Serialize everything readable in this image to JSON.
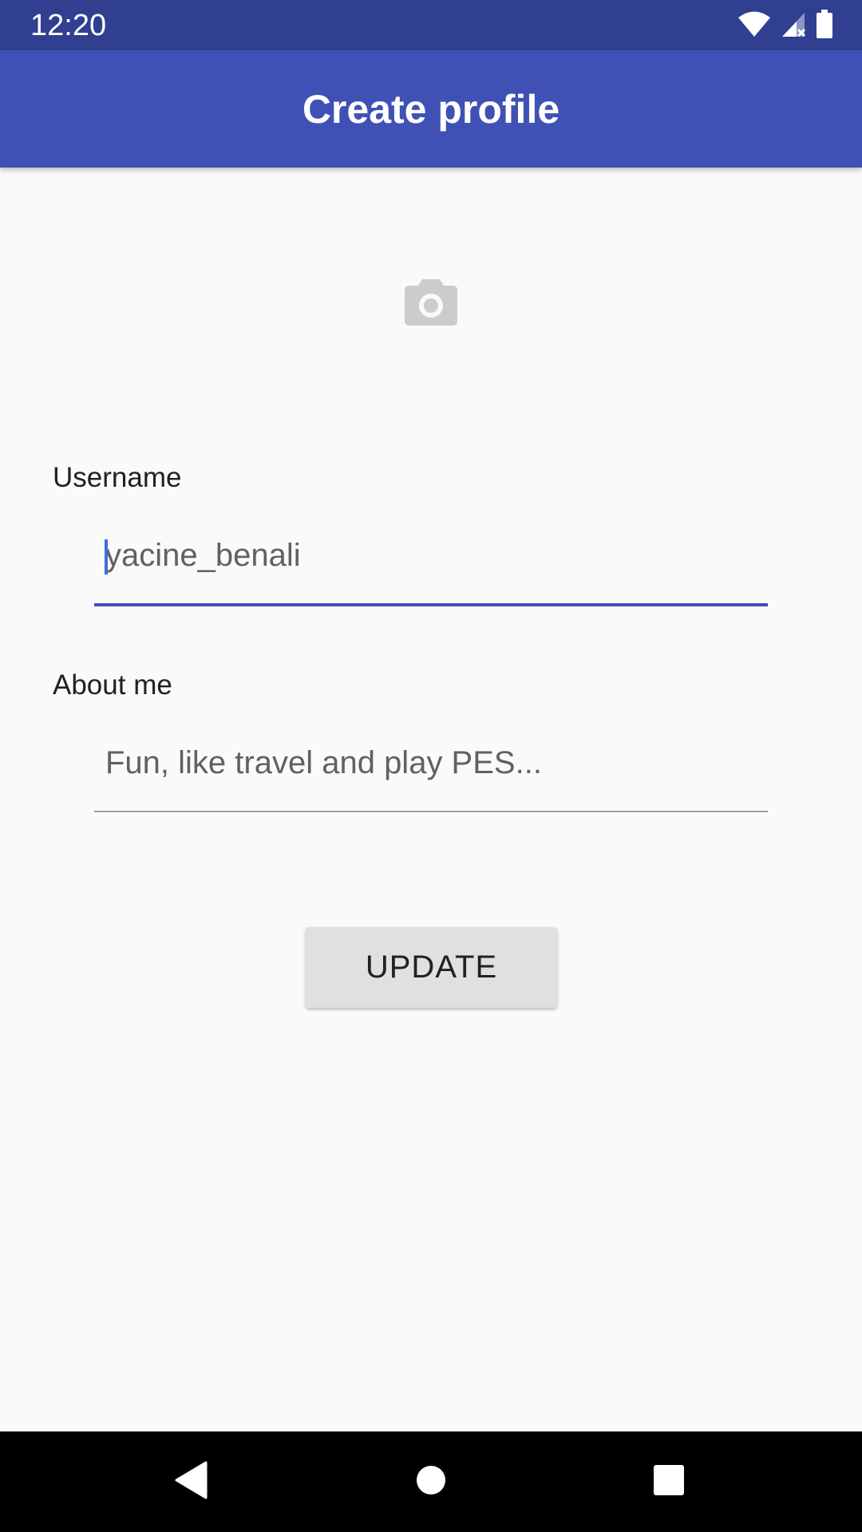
{
  "status_bar": {
    "time": "12:20",
    "icons": [
      "wifi-icon",
      "cell-signal-icon",
      "battery-icon"
    ]
  },
  "app_bar": {
    "title": "Create profile"
  },
  "profile_photo": {
    "icon": "camera-icon"
  },
  "form": {
    "username": {
      "label": "Username",
      "value": "yacine_benali",
      "placeholder": ""
    },
    "about": {
      "label": "About me",
      "value": "",
      "placeholder": "Fun, like travel and play PES..."
    },
    "submit_label": "UPDATE"
  },
  "nav_bar": {
    "icons": [
      "back-icon",
      "home-icon",
      "recents-icon"
    ]
  },
  "colors": {
    "status_bar": "#303f8f",
    "primary": "#3f51b5",
    "background": "#fafafa",
    "button": "#e0e0e0"
  }
}
